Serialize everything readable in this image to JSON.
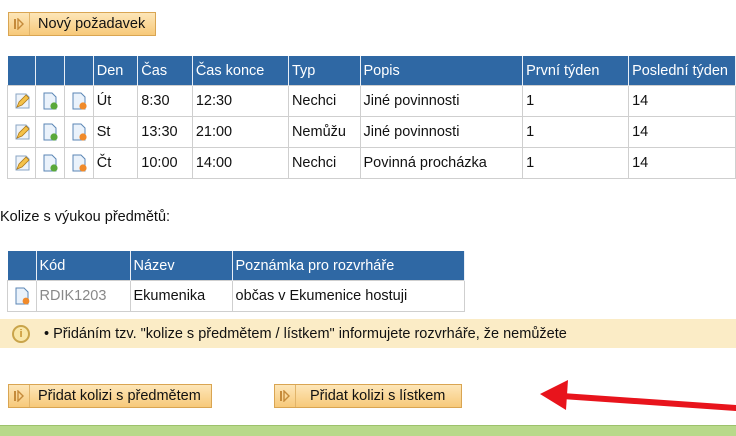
{
  "new_request_button": "Nový požadavek",
  "requests_table": {
    "headers": [
      "Den",
      "Čas",
      "Čas konce",
      "Typ",
      "Popis",
      "První týden",
      "Poslední týden"
    ],
    "rows": [
      {
        "den": "Út",
        "cas": "8:30",
        "konec": "12:30",
        "typ": "Nechci",
        "popis": "Jiné povinnosti",
        "prvni": "1",
        "posledni": "14"
      },
      {
        "den": "St",
        "cas": "13:30",
        "konec": "21:00",
        "typ": "Nemůžu",
        "popis": "Jiné povinnosti",
        "prvni": "1",
        "posledni": "14"
      },
      {
        "den": "Čt",
        "cas": "10:00",
        "konec": "14:00",
        "typ": "Nechci",
        "popis": "Povinná procházka",
        "prvni": "1",
        "posledni": "14"
      }
    ]
  },
  "collision_heading": "Kolize s výukou předmětů:",
  "subjects_table": {
    "headers": [
      "Kód",
      "Název",
      "Poznámka pro rozvrháře"
    ],
    "rows": [
      {
        "kod": "RDIK1203",
        "nazev": "Ekumenika",
        "poznamka": "občas v Ekumenice hostuji"
      }
    ]
  },
  "info_text": "• Přidáním tzv. \"kolize s předmětem / lístkem\" informujete rozvrháře, že nemůžete",
  "add_subject_button": "Přidat kolizi s předmětem",
  "add_ticket_button": "Přidat kolizi s lístkem",
  "colors": {
    "header_bg": "#2f68a4",
    "button_bg": "#f7c97a",
    "info_bg": "#fbecc6",
    "arrow": "#e8141c"
  },
  "icons": [
    "edit-icon",
    "copy-doc-icon",
    "delete-doc-icon",
    "doc-icon",
    "info-icon",
    "arrow-annotation"
  ]
}
